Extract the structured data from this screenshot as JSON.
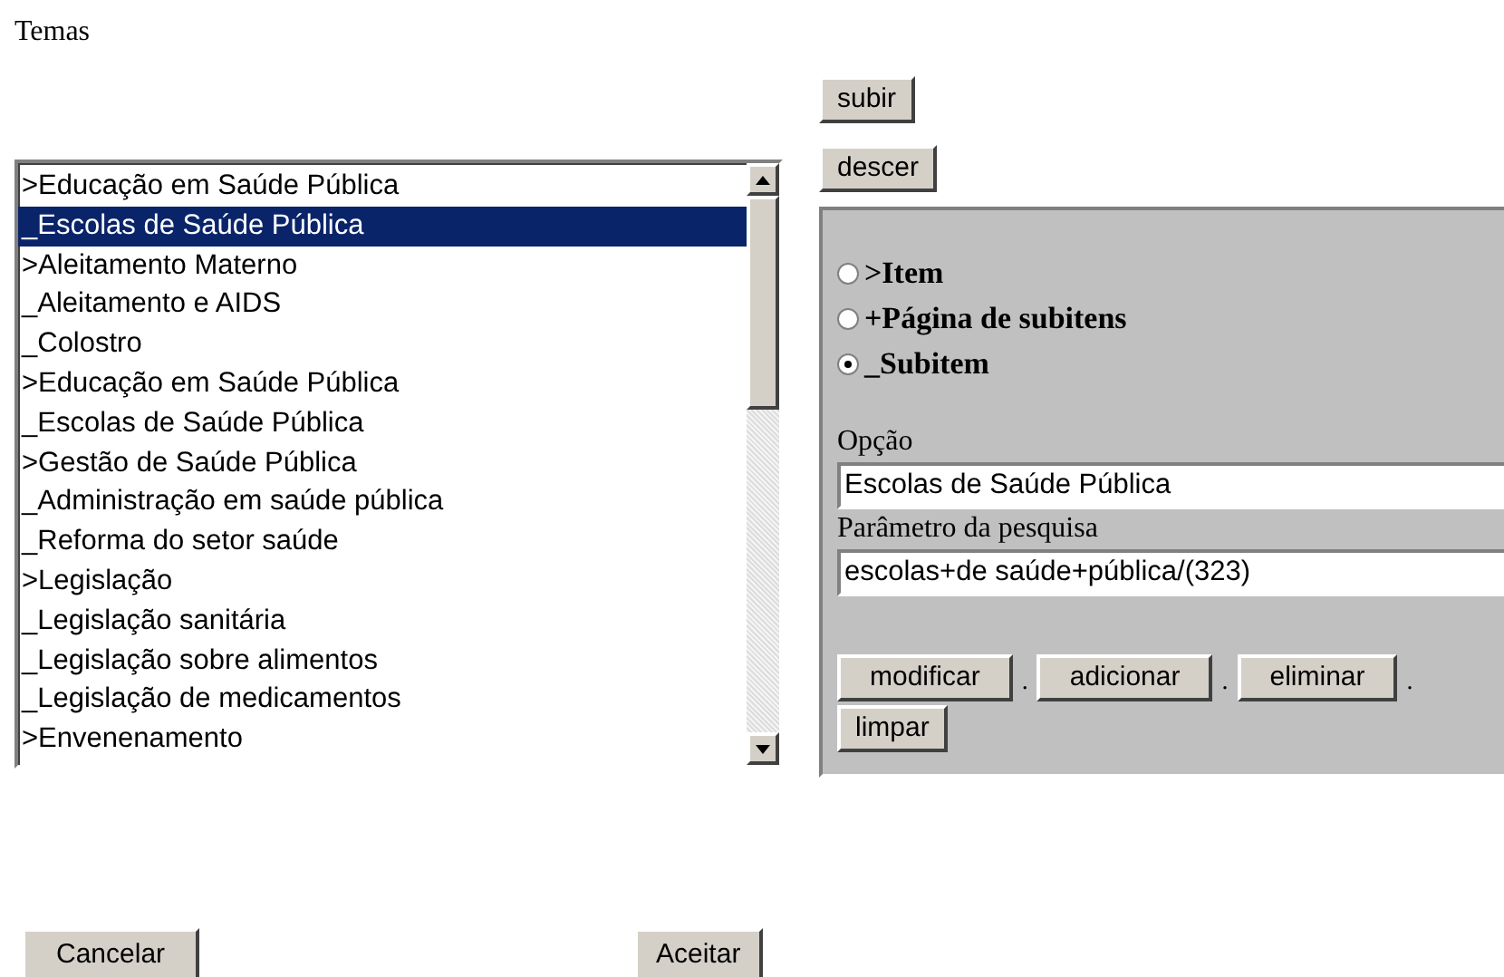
{
  "title": "Temas",
  "move_buttons": [
    "subir",
    "descer"
  ],
  "list": {
    "items": [
      {
        "label": ">Educação em Saúde Pública",
        "selected": false
      },
      {
        "label": "_Escolas de Saúde Pública",
        "selected": true
      },
      {
        "label": ">Aleitamento Materno",
        "selected": false
      },
      {
        "label": "_Aleitamento e AIDS",
        "selected": false
      },
      {
        "label": "_Colostro",
        "selected": false
      },
      {
        "label": ">Educação em Saúde Pública",
        "selected": false
      },
      {
        "label": "_Escolas de Saúde Pública",
        "selected": false
      },
      {
        "label": ">Gestão de Saúde Pública",
        "selected": false
      },
      {
        "label": "_Administração em saúde pública",
        "selected": false
      },
      {
        "label": "_Reforma do setor saúde",
        "selected": false
      },
      {
        "label": ">Legislação",
        "selected": false
      },
      {
        "label": "_Legislação sanitária",
        "selected": false
      },
      {
        "label": "_Legislação sobre alimentos",
        "selected": false
      },
      {
        "label": "_Legislação de medicamentos",
        "selected": false
      },
      {
        "label": ">Envenenamento",
        "selected": false
      }
    ]
  },
  "types": [
    {
      "label": ">Item",
      "selected": false
    },
    {
      "label": "+Página de subitens",
      "selected": false
    },
    {
      "label": "_Subitem",
      "selected": true
    }
  ],
  "fields": [
    {
      "label": "Opção",
      "value": "Escolas de Saúde Pública"
    },
    {
      "label": "Parâmetro da pesquisa",
      "value": "escolas+de saúde+pública/(323)"
    }
  ],
  "actions": [
    {
      "label": "modificar",
      "separator": "."
    },
    {
      "label": "adicionar",
      "separator": "."
    },
    {
      "label": "eliminar",
      "separator": "."
    },
    {
      "label": "limpar"
    }
  ],
  "footer_buttons": [
    "Cancelar",
    "Aceitar"
  ]
}
